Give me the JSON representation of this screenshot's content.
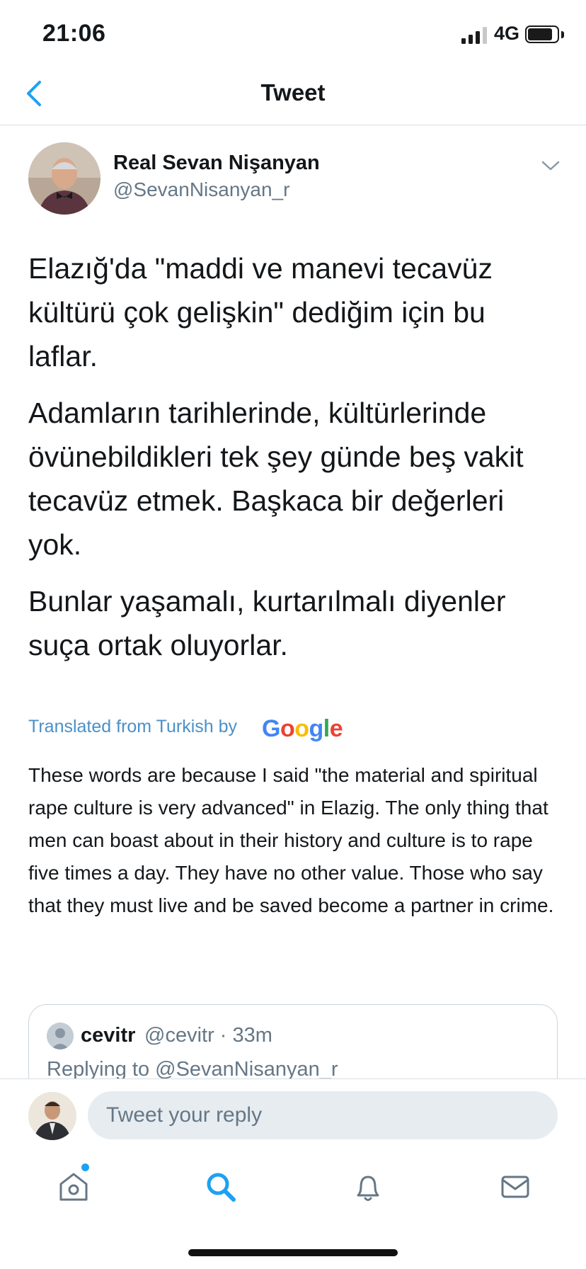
{
  "status_bar": {
    "time": "21:06",
    "network": "4G",
    "battery_level": 0.78,
    "signal_bars": 3
  },
  "nav": {
    "title": "Tweet"
  },
  "tweet": {
    "author_name": "Real Sevan Nişanyan",
    "author_handle": "@SevanNisanyan_r",
    "paragraphs": [
      "Elazığ'da \"maddi ve manevi tecavüz kültürü çok gelişkin\" dediğim için bu laflar.",
      "Adamların tarihlerinde, kültürlerinde övünebildikleri tek şey günde beş vakit tecavüz etmek. Başkaca bir değerleri yok.",
      "Bunlar yaşamalı, kurtarılmalı diyenler suça ortak oluyorlar."
    ],
    "translated_label": "Translated from Turkish by",
    "translation_provider": "Google",
    "translation": "These words are because I said \"the material and spiritual rape culture is very advanced\" in Elazig. The only thing that men can boast about in their history and culture is to rape five times a day. They have no other value. Those who say that they must live and be saved become a partner in crime."
  },
  "reply_card": {
    "name": "cevitr",
    "meta": "@cevitr · 33m",
    "replying_to": "Replying to @SevanNisanyan_r"
  },
  "reply_bar": {
    "placeholder": "Tweet your reply"
  },
  "tabs": [
    {
      "icon": "home-icon",
      "has_notification_dot": true
    },
    {
      "icon": "search-icon",
      "active": true
    },
    {
      "icon": "bell-icon"
    },
    {
      "icon": "mail-icon"
    }
  ],
  "colors": {
    "accent": "#1da1f2",
    "secondary_text": "#657786",
    "divider": "#d9dee2"
  }
}
